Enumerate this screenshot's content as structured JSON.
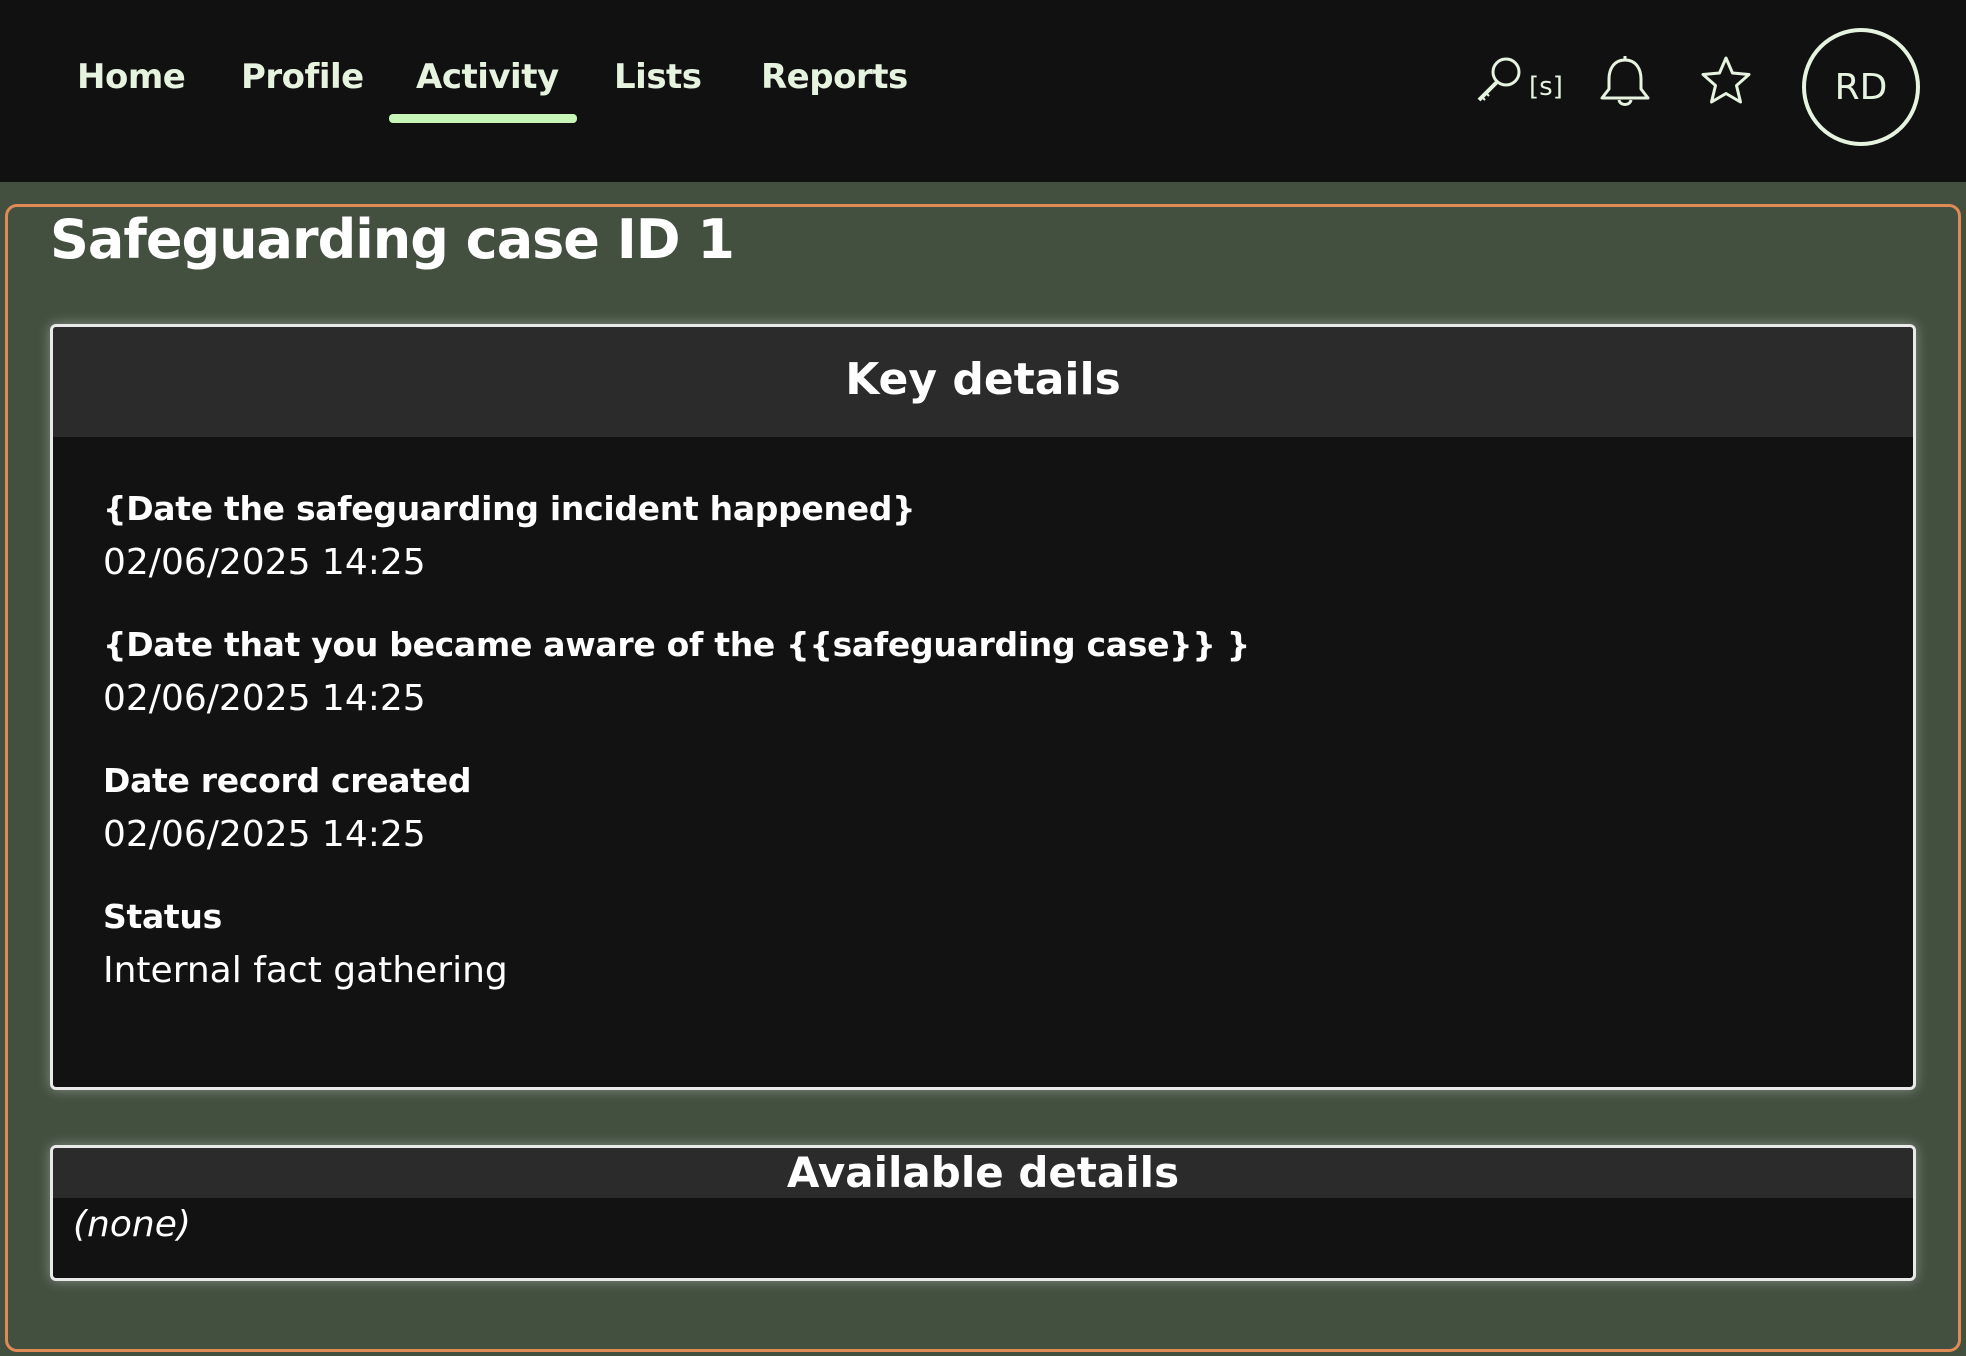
{
  "nav": {
    "items": [
      {
        "label": "Home"
      },
      {
        "label": "Profile"
      },
      {
        "label": "Activity"
      },
      {
        "label": "Lists"
      },
      {
        "label": "Reports"
      }
    ],
    "active": "Activity",
    "search_hint": "[s]",
    "avatar_initials": "RD",
    "icons": [
      "search-icon",
      "bell-icon",
      "star-icon"
    ]
  },
  "page": {
    "title": "Safeguarding case ID 1"
  },
  "key_details": {
    "heading": "Key details",
    "fields": [
      {
        "label": "{Date the safeguarding incident happened}",
        "value": "02/06/2025 14:25"
      },
      {
        "label": "{Date that you became aware of the {{safeguarding case}} }",
        "value": "02/06/2025 14:25"
      },
      {
        "label": "Date record created",
        "value": "02/06/2025 14:25"
      },
      {
        "label": "Status",
        "value": "Internal fact gathering"
      }
    ]
  },
  "available_details": {
    "heading": "Available details",
    "empty_text": "(none)"
  },
  "colors": {
    "page_bg": "#435040",
    "topbar_bg": "#111111",
    "active_underline": "#c8f5b8",
    "main_outline": "#e08a56",
    "card_bg": "#121212",
    "card_header_bg": "#2b2b2b"
  }
}
